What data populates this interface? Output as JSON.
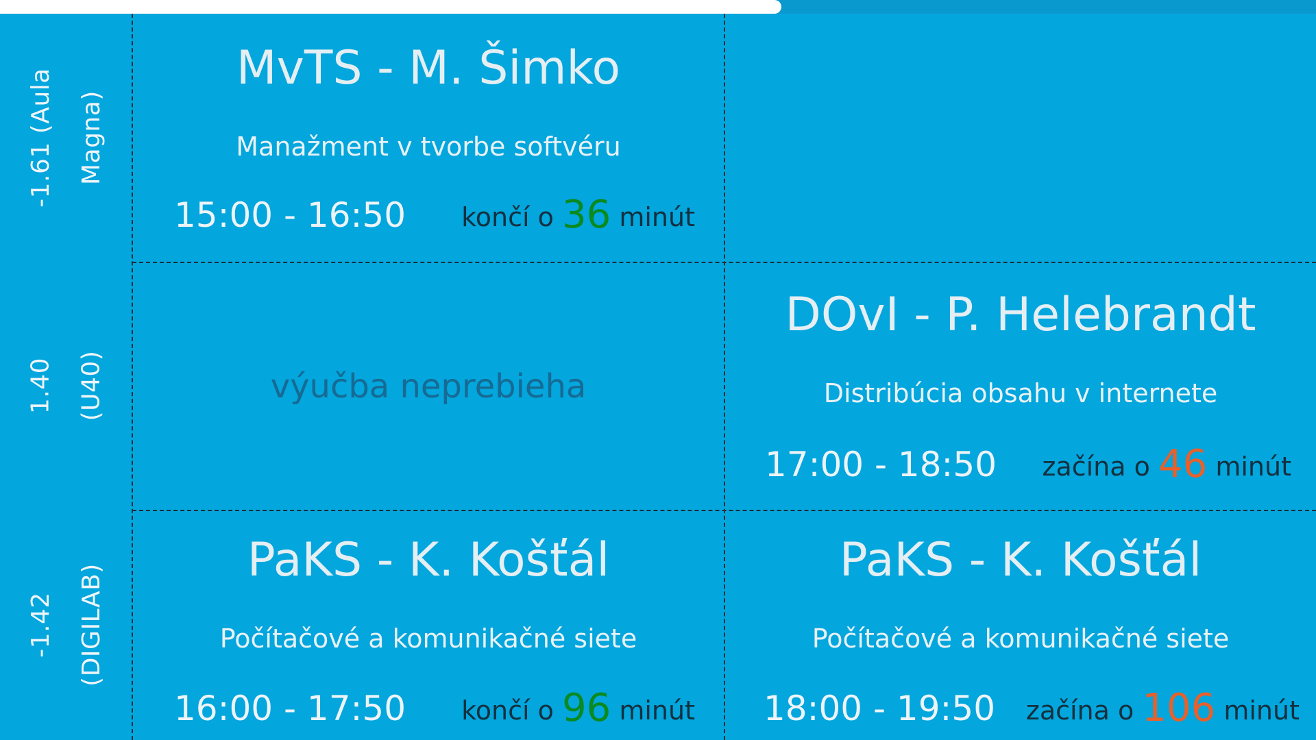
{
  "progress": {
    "fraction": 0.594
  },
  "colors": {
    "background": "#03a6dd",
    "ending_accent": "#0a8a1f",
    "starting_accent": "#e8602a",
    "grid_lines": "#1d2e3a"
  },
  "rooms": [
    {
      "line1": "-1.61 (Aula",
      "line2": "Magna)"
    },
    {
      "line1": "1.40",
      "line2": "(U40)"
    },
    {
      "line1": "-1.42",
      "line2": "(DIGILAB)"
    }
  ],
  "cells": {
    "r1c1": {
      "title": "MvTS - M. Šimko",
      "subtitle": "Manažment v tvorbe softvéru",
      "time": "15:00 - 16:50",
      "status_prefix": "končí o",
      "status_value": "36",
      "status_suffix": "minút"
    },
    "r2c1": {
      "empty_text": "výučba neprebieha"
    },
    "r2c2": {
      "title": "DOvI - P. Helebrandt",
      "subtitle": "Distribúcia obsahu v internete",
      "time": "17:00 - 18:50",
      "status_prefix": "začína o",
      "status_value": "46",
      "status_suffix": "minút"
    },
    "r3c1": {
      "title": "PaKS - K. Košťál",
      "subtitle": "Počítačové a komunikačné siete",
      "time": "16:00 - 17:50",
      "status_prefix": "končí o",
      "status_value": "96",
      "status_suffix": "minút"
    },
    "r3c2": {
      "title": "PaKS - K. Košťál",
      "subtitle": "Počítačové a komunikačné siete",
      "time": "18:00 - 19:50",
      "status_prefix": "začína o",
      "status_value": "106",
      "status_suffix": "minút"
    }
  }
}
